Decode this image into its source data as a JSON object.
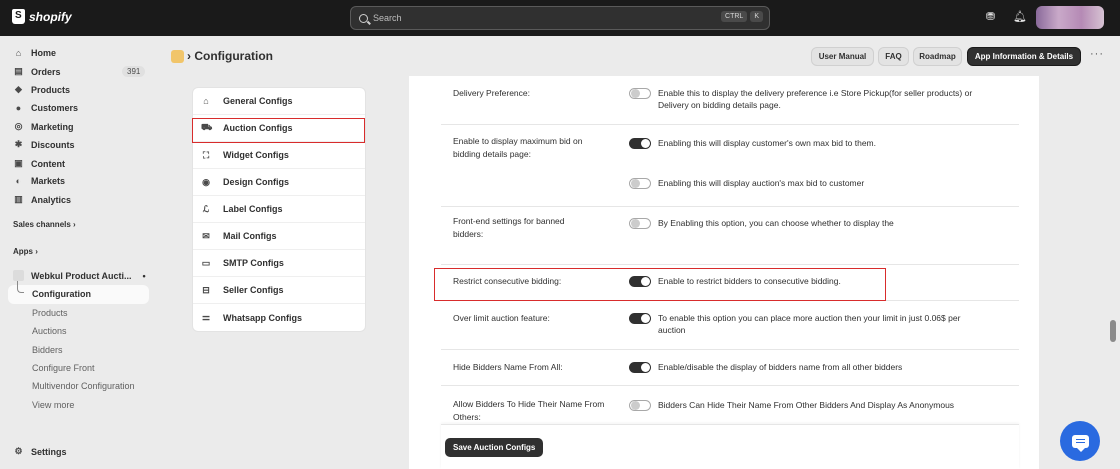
{
  "topbar": {
    "brand": "shopify",
    "search_placeholder": "Search",
    "shortcut_keys": [
      "CTRL",
      "K"
    ]
  },
  "sidebar": {
    "items": [
      {
        "label": "Home",
        "icon": "home-icon"
      },
      {
        "label": "Orders",
        "icon": "orders-icon",
        "count": "391"
      },
      {
        "label": "Products",
        "icon": "tag-icon"
      },
      {
        "label": "Customers",
        "icon": "person-icon"
      },
      {
        "label": "Marketing",
        "icon": "target-icon"
      },
      {
        "label": "Discounts",
        "icon": "discount-icon"
      },
      {
        "label": "Content",
        "icon": "content-icon"
      },
      {
        "label": "Markets",
        "icon": "globe-icon"
      },
      {
        "label": "Analytics",
        "icon": "chart-icon"
      }
    ],
    "sales_channels_label": "Sales channels",
    "apps_label": "Apps",
    "app_name": "Webkul Product Aucti...",
    "active_sub": "Configuration",
    "sub_items": [
      "Products",
      "Auctions",
      "Bidders",
      "Configure Front",
      "Multivendor Configuration",
      "View more"
    ],
    "settings_label": "Settings"
  },
  "header": {
    "title": "Configuration",
    "buttons": [
      "User Manual",
      "FAQ",
      "Roadmap",
      "App Information & Details"
    ]
  },
  "config_nav": [
    {
      "label": "General Configs",
      "icon": "home-icon"
    },
    {
      "label": "Auction Configs",
      "icon": "cart-icon"
    },
    {
      "label": "Widget Configs",
      "icon": "frame-icon"
    },
    {
      "label": "Design Configs",
      "icon": "eye-icon"
    },
    {
      "label": "Label Configs",
      "icon": "label-icon"
    },
    {
      "label": "Mail Configs",
      "icon": "mail-icon"
    },
    {
      "label": "SMTP Configs",
      "icon": "envelope-icon"
    },
    {
      "label": "Seller Configs",
      "icon": "seller-icon"
    },
    {
      "label": "Whatsapp Configs",
      "icon": "sliders-icon"
    }
  ],
  "settings": [
    {
      "label": "Delivery Preference:",
      "options": [
        {
          "on": false,
          "text": "Enable this to display the delivery preference i.e Store Pickup(for seller products) or Delivery on bidding details page."
        }
      ]
    },
    {
      "label": "Enable to display maximum bid on bidding details page:",
      "options": [
        {
          "on": true,
          "text": "Enabling this will display customer's own max bid to them."
        },
        {
          "on": false,
          "text": "Enabling this will display auction's max bid to customer"
        }
      ]
    },
    {
      "label": "Front-end settings for banned bidders:",
      "options": [
        {
          "on": false,
          "text": "By Enabling this option, you can choose whether to display the"
        }
      ]
    },
    {
      "label": "Restrict consecutive bidding:",
      "options": [
        {
          "on": true,
          "text": "Enable to restrict bidders to consecutive bidding."
        }
      ]
    },
    {
      "label": "Over limit auction feature:",
      "options": [
        {
          "on": true,
          "text": "To enable this option you can place more auction then your limit in just 0.06$ per auction"
        }
      ]
    },
    {
      "label": "Hide Bidders Name From All:",
      "options": [
        {
          "on": true,
          "text": "Enable/disable the display of bidders name from all other bidders"
        }
      ]
    },
    {
      "label": "Allow Bidders To Hide Their Name From Others:",
      "options": [
        {
          "on": false,
          "text": "Bidders Can Hide Their Name From Other Bidders And Display As Anonymous"
        }
      ]
    }
  ],
  "save_button": "Save Auction Configs",
  "colors": {
    "accent_red": "#d82c2c",
    "fab_blue": "#2a6ae0",
    "topbar": "#1a1a1a"
  }
}
